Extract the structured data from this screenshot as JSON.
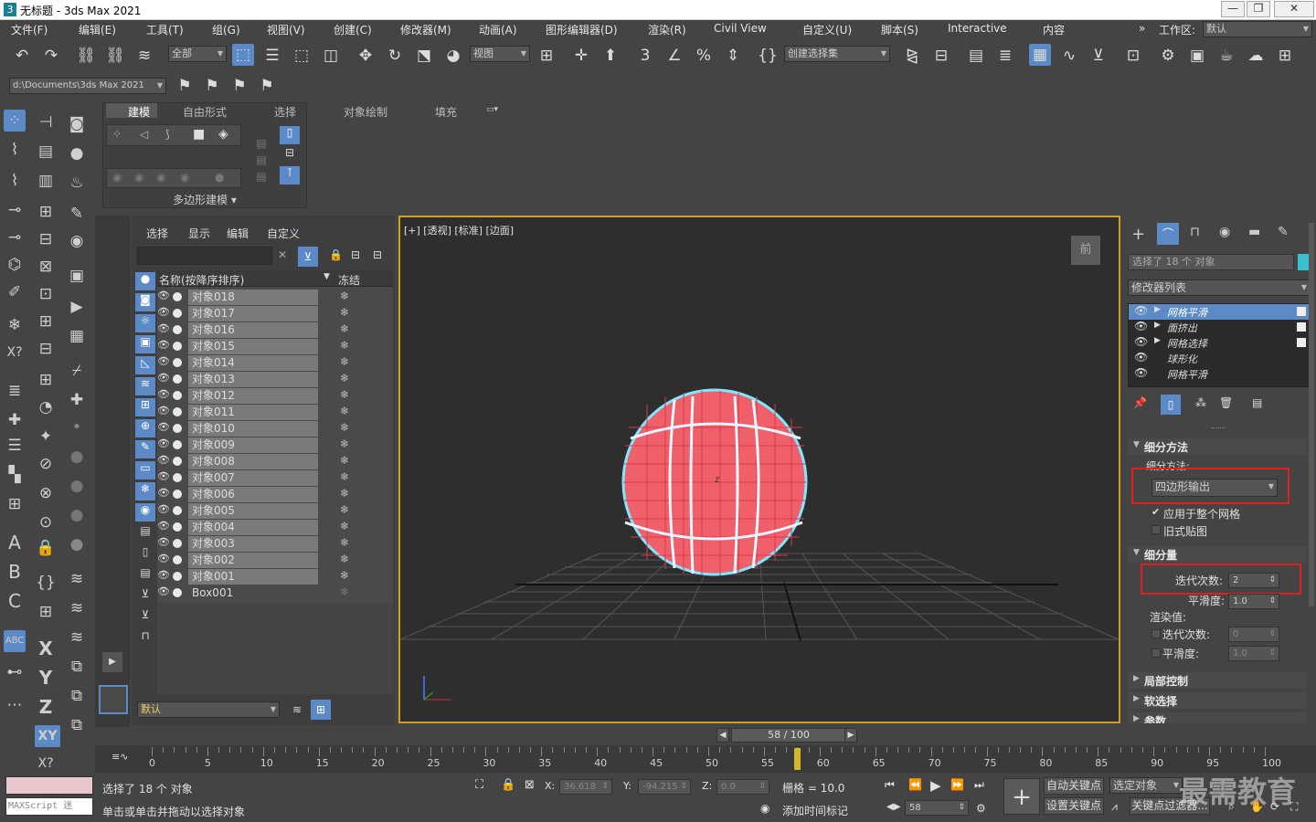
{
  "window": {
    "title": "无标题 - 3ds Max 2021",
    "logo": "3"
  },
  "menu": [
    "文件(F)",
    "编辑(E)",
    "工具(T)",
    "组(G)",
    "视图(V)",
    "创建(C)",
    "修改器(M)",
    "动画(A)",
    "图形编辑器(D)",
    "渲染(R)",
    "Civil View",
    "自定义(U)",
    "脚本(S)",
    "Interactive",
    "内容"
  ],
  "workspace": {
    "label": "工作区:",
    "value": "默认",
    "chevron": "»"
  },
  "toolbar": {
    "filter": "全部",
    "refcoord": "视图",
    "selset": "创建选择集"
  },
  "path": {
    "value": "d:\\Documents\\3ds Max 2021"
  },
  "ribbon": {
    "tabs": [
      "建模",
      "自由形式",
      "选择",
      "对象绘制",
      "填充"
    ],
    "group_label": "多边形建模"
  },
  "scene_explorer": {
    "tabs": [
      "选择",
      "显示",
      "编辑",
      "自定义"
    ],
    "col_name": "名称(按降序排序)",
    "col_freeze": "冻结",
    "rows": [
      "对象018",
      "对象017",
      "对象016",
      "对象015",
      "对象014",
      "对象013",
      "对象012",
      "对象011",
      "对象010",
      "对象009",
      "对象008",
      "对象007",
      "对象006",
      "对象005",
      "对象004",
      "对象003",
      "对象002",
      "对象001",
      "Box001"
    ],
    "layer": "默认"
  },
  "viewport": {
    "label": "[+] [透视] [标准] [边面]",
    "viewcube": "前",
    "axis_z": "z"
  },
  "cmd_panel": {
    "selected_text": "选择了 18 个 对象",
    "modifier_list": "修改器列表",
    "stack": [
      "网格平滑",
      "面挤出",
      "网格选择",
      "球形化",
      "网格平滑"
    ],
    "sec_subdiv": "细分方法",
    "subdiv_label": "细分方法:",
    "subdiv_value": "四边形输出",
    "apply_whole": "应用于整个网格",
    "old_map": "旧式贴图",
    "sec_amount": "细分量",
    "iter_label": "迭代次数:",
    "iter_value": "2",
    "smooth_label": "平滑度:",
    "smooth_value": "1.0",
    "render_label": "渲染值:",
    "r_iter_label": "迭代次数:",
    "r_iter_value": "0",
    "r_smooth_label": "平滑度:",
    "r_smooth_value": "1.0",
    "sec_local": "局部控制",
    "sec_soft": "软选择",
    "sec_params": "参数"
  },
  "timeline": {
    "frame": "58 / 100",
    "ticks": [
      "0",
      "5",
      "10",
      "15",
      "20",
      "25",
      "30",
      "35",
      "40",
      "45",
      "50",
      "55",
      "60",
      "65",
      "70",
      "75",
      "80",
      "85",
      "90",
      "95",
      "100"
    ],
    "current_fraction": 0.58
  },
  "status": {
    "maxscript": "MAXScript 迷",
    "selected": "选择了 18 个 对象",
    "prompt": "单击或单击并拖动以选择对象",
    "x_label": "X:",
    "x": "36.618",
    "y_label": "Y:",
    "y": "-94.215",
    "z_label": "Z:",
    "z": "0.0",
    "grid": "栅格 = 10.0",
    "add_time_tag": "添加时间标记",
    "frame_field": "58",
    "auto_key": "自动关键点",
    "set_key": "设置关键点",
    "selected_obj": "选定对象",
    "key_filter": "关键点过滤器...",
    "watermark": "最需教育"
  },
  "colors": {
    "accent": "#5b8ac7",
    "viewport_border": "#c9a227",
    "highlight_red": "#e02020",
    "object_pink": "#f0606a",
    "selection_cyan": "#7fe8ff"
  }
}
